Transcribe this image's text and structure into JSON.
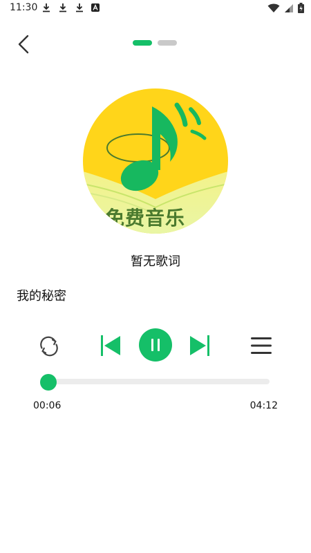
{
  "status_bar": {
    "time": "11:30",
    "left_icons": [
      "download-icon",
      "download-icon",
      "download-icon",
      "a-badge-icon"
    ],
    "right_icons": [
      "wifi-icon",
      "signal-icon",
      "battery-icon"
    ]
  },
  "header": {
    "back_icon": "chevron-left-icon",
    "pager": {
      "count": 2,
      "active_index": 0
    }
  },
  "album_cover": {
    "text": "免费音乐",
    "colors": {
      "background": "#ffd51a",
      "note": "#17b85f"
    }
  },
  "lyrics": {
    "text": "暂无歌词"
  },
  "song": {
    "title": "我的秘密"
  },
  "controls": {
    "repeat_icon": "repeat-icon",
    "prev_icon": "skip-previous-icon",
    "play_pause_icon": "pause-icon",
    "next_icon": "skip-next-icon",
    "playlist_icon": "menu-icon"
  },
  "progress": {
    "current_time": "00:06",
    "total_time": "04:12",
    "fraction": 0.024
  },
  "colors": {
    "accent": "#15bf68",
    "text": "#111111",
    "track": "#ececec"
  }
}
